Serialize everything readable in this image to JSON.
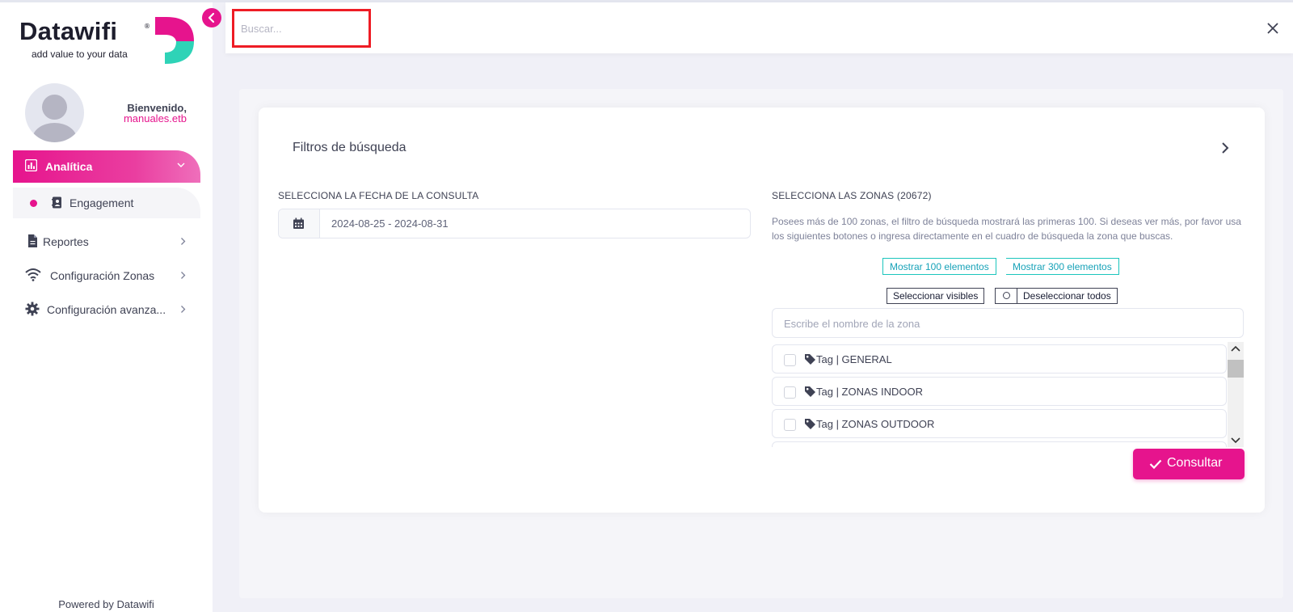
{
  "brand": {
    "name": "Datawifi",
    "tagline": "add value to your data",
    "reg": "®",
    "accent": "#e6148d",
    "teal": "#2ed3b7"
  },
  "user": {
    "welcome": "Bienvenido,",
    "username": "manuales.etb"
  },
  "sidebar": {
    "items": [
      {
        "label": "Analítica",
        "icon": "bar-chart-icon",
        "active": true
      },
      {
        "label": "Engagement",
        "icon": "contact-card-icon"
      },
      {
        "label": "Reportes",
        "icon": "file-icon"
      },
      {
        "label": "Configuración Zonas",
        "icon": "wifi-icon"
      },
      {
        "label": "Configuración avanza...",
        "icon": "gear-icon"
      }
    ],
    "footer": "Powered by Datawifi"
  },
  "header": {
    "search_placeholder": "Buscar..."
  },
  "filters": {
    "title": "Filtros de búsqueda",
    "date_label": "SELECCIONA LA FECHA DE LA CONSULTA",
    "date_value": "2024-08-25 - 2024-08-31",
    "zones_label": "SELECCIONA LAS ZONAS (20672)",
    "zones_info": "Posees más de 100 zonas, el filtro de búsqueda mostrará las primeras 100. Si deseas ver más, por favor usa los siguientes botones o ingresa directamente en el cuadro de búsqueda la zona que buscas.",
    "show_100": "Mostrar 100 elementos",
    "show_300": "Mostrar 300 elementos",
    "select_visible": "Seleccionar visibles",
    "deselect_all": "Deseleccionar todos",
    "zone_search_placeholder": "Escribe el nombre de la zona",
    "zones": [
      "Tag | GENERAL",
      "Tag | ZONAS INDOOR",
      "Tag | ZONAS OUTDOOR"
    ],
    "submit": "Consultar"
  }
}
